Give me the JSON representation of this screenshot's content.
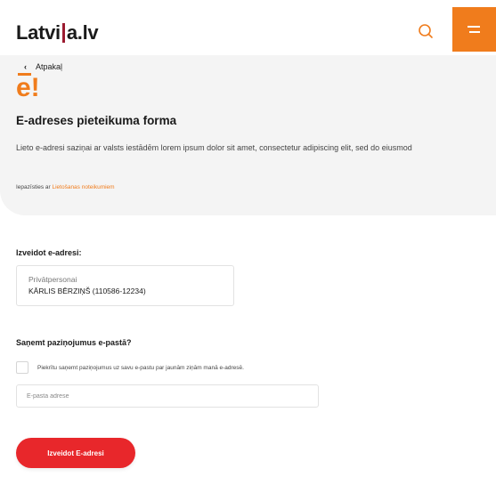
{
  "header": {
    "logo_text_a": "Latvi",
    "logo_text_b": "a.lv",
    "search_icon": "search-icon",
    "menu_icon": "hamburger-menu-icon",
    "accent_color": "#f07c1c"
  },
  "intro": {
    "back_label": "Atpakaļ",
    "e_logo": "e!",
    "title": "E-adreses pieteikuma forma",
    "description": "Lieto e-adresi saziņai ar valsts iestādēm lorem ipsum dolor sit amet, consectetur adipiscing elit, sed do eiusmod",
    "terms_prefix": "Iepazīsties ar",
    "terms_link": "Lietošanas noteikumiem"
  },
  "create": {
    "label": "Izveidot e-adresi:",
    "person_type": "Privātpersonai",
    "person_name": "KĀRLIS BĒRZIŅŠ (110586-12234)"
  },
  "notify": {
    "label": "Saņemt paziņojumus e-pastā?",
    "checkbox_label": "Piekrītu saņemt paziņojumus uz savu e-pastu par jaunām ziņām manā e-adresē.",
    "checkbox_checked": false,
    "email_placeholder": "E-pasta adrese",
    "email_value": ""
  },
  "submit": {
    "label": "Izveidot E-adresi",
    "color": "#e8272b"
  }
}
